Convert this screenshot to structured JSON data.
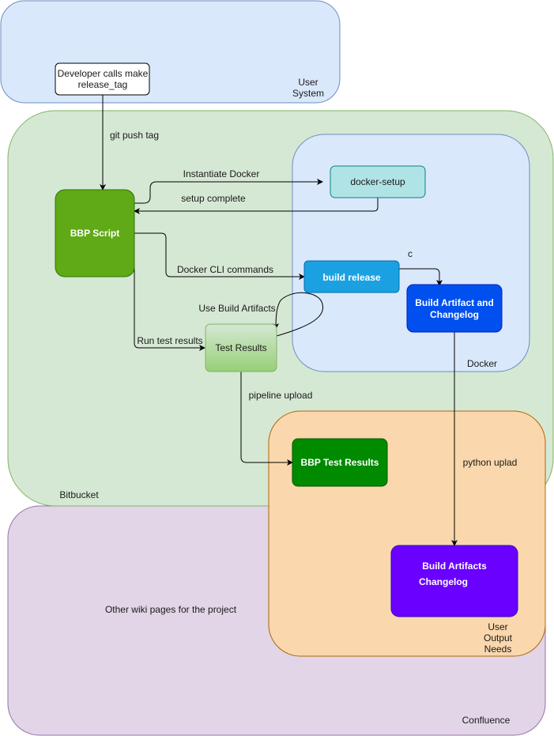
{
  "containers": {
    "user_system": {
      "label_line1": "User",
      "label_line2": "System",
      "fill": "#dae8fc",
      "stroke": "#6c8ebf"
    },
    "bitbucket": {
      "label": "Bitbucket",
      "fill": "#d5e8d4",
      "stroke": "#82b366"
    },
    "confluence": {
      "label": "Confluence",
      "note": "Other wiki pages for the project",
      "fill": "#e1d5e7",
      "stroke": "#9673a6"
    },
    "docker": {
      "label": "Docker",
      "fill": "#dae8fc",
      "stroke": "#6c8ebf"
    },
    "user_output_needs": {
      "label_line1": "User",
      "label_line2": "Output",
      "label_line3": "Needs",
      "fill": "#fad7ac",
      "stroke": "#b46504"
    }
  },
  "nodes": {
    "developer": {
      "line1": "Developer calls make",
      "line2": "release_tag"
    },
    "bbp_script": {
      "label": "BBP Script",
      "fill": "#60a917"
    },
    "docker_setup": {
      "label": "docker-setup",
      "fill": "#b0e3e6"
    },
    "build_release": {
      "label": "build release",
      "fill": "#1ba1e2"
    },
    "build_artifact": {
      "line1": "Build Artifact and",
      "line2": "Changelog",
      "fill": "#0050ef"
    },
    "test_results": {
      "label": "Test Results"
    },
    "bbp_test_results": {
      "label": "BBP Test Results",
      "fill": "#008a00"
    },
    "build_artifacts_out": {
      "line1": "Build Artifacts",
      "line2": "Changelog",
      "fill": "#6a00ff"
    }
  },
  "edges": {
    "git_push": "git push tag",
    "instantiate": "Instantiate Docker",
    "setup_complete": "setup complete",
    "docker_cli": "Docker CLI commands",
    "c": "c",
    "run_tests": "Run test results",
    "use_artifacts": "Use Build Artifacts",
    "pipeline_upload": "pipeline upload",
    "python_upload": "python uplad"
  }
}
